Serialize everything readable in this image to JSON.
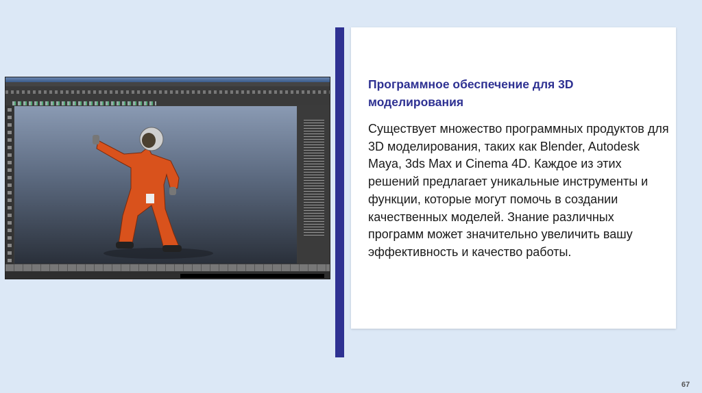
{
  "slide": {
    "title": "Программное обеспечение для 3D моделирования",
    "body": "Существует множество программных продуктов для 3D моделирования, таких как Blender, Autodesk Maya, 3ds Max и Cinema 4D. Каждое из этих решений предлагает уникальные инструменты и функции, которые могут помочь в создании качественных моделей. Знание различных программ может значительно увеличить вашу эффективность и качество работы.",
    "page_number": "67"
  },
  "image": {
    "description_icon": "3d-software-screenshot"
  },
  "colors": {
    "accent": "#2e3192",
    "background": "#dce8f6",
    "card": "#ffffff"
  }
}
